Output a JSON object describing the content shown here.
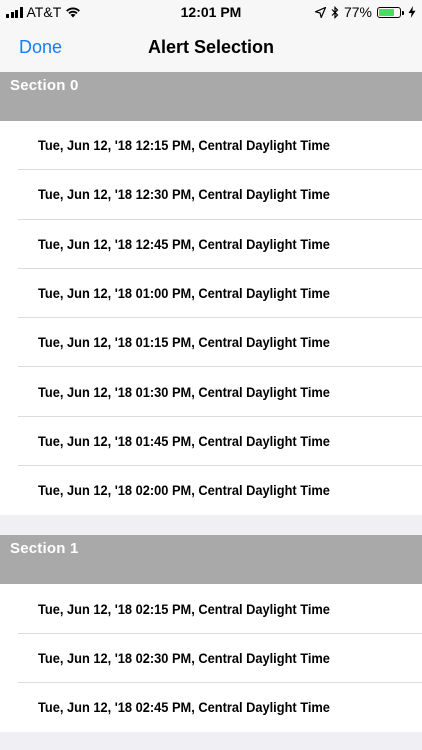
{
  "status_bar": {
    "carrier": "AT&T",
    "time": "12:01 PM",
    "battery_percent": "77%",
    "battery_level": 0.77,
    "battery_color": "#4cd964"
  },
  "nav": {
    "back_label": "Done",
    "title": "Alert Selection"
  },
  "accent_color": "#147efb",
  "sections": [
    {
      "header": "Section 0",
      "rows": [
        "Tue, Jun 12, '18 12:15 PM, Central Daylight Time",
        "Tue, Jun 12, '18 12:30 PM, Central Daylight Time",
        "Tue, Jun 12, '18 12:45 PM, Central Daylight Time",
        "Tue, Jun 12, '18 01:00 PM, Central Daylight Time",
        "Tue, Jun 12, '18 01:15 PM, Central Daylight Time",
        "Tue, Jun 12, '18 01:30 PM, Central Daylight Time",
        "Tue, Jun 12, '18 01:45 PM, Central Daylight Time",
        "Tue, Jun 12, '18 02:00 PM, Central Daylight Time"
      ]
    },
    {
      "header": "Section 1",
      "rows": [
        "Tue, Jun 12, '18 02:15 PM, Central Daylight Time",
        "Tue, Jun 12, '18 02:30 PM, Central Daylight Time",
        "Tue, Jun 12, '18 02:45 PM, Central Daylight Time"
      ]
    }
  ]
}
